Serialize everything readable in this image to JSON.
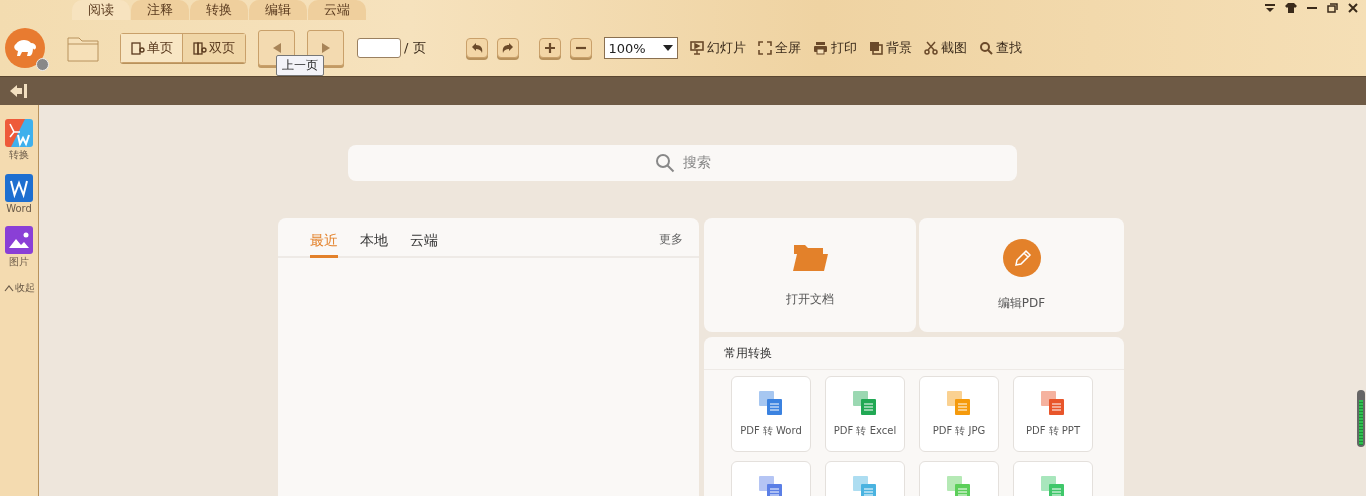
{
  "menu_tabs": [
    {
      "label": "阅读",
      "selected": true
    },
    {
      "label": "注释",
      "selected": false
    },
    {
      "label": "转换",
      "selected": false
    },
    {
      "label": "编辑",
      "selected": false
    },
    {
      "label": "云端",
      "selected": false
    }
  ],
  "toolbar": {
    "view_modes": [
      {
        "label": "单页",
        "selected": true
      },
      {
        "label": "双页",
        "selected": false
      }
    ],
    "tooltip": "上一页",
    "page_suffix": "/ 页",
    "zoom": "100%",
    "actions": [
      {
        "label": "幻灯片",
        "kind": "slideshow"
      },
      {
        "label": "全屏",
        "kind": "fullscreen"
      },
      {
        "label": "打印",
        "kind": "print"
      },
      {
        "label": "背景",
        "kind": "background"
      },
      {
        "label": "截图",
        "kind": "screenshot"
      },
      {
        "label": "查找",
        "kind": "search"
      }
    ]
  },
  "sidebar": {
    "items": [
      {
        "label": "转换",
        "kind": "convert"
      },
      {
        "label": "Word",
        "kind": "word"
      },
      {
        "label": "图片",
        "kind": "image"
      }
    ],
    "collapse": "收起"
  },
  "search": {
    "placeholder": "搜索"
  },
  "files": {
    "tabs": [
      {
        "label": "最近",
        "selected": true
      },
      {
        "label": "本地",
        "selected": false
      },
      {
        "label": "云端",
        "selected": false
      }
    ],
    "more": "更多"
  },
  "quick_actions": [
    {
      "label": "打开文档",
      "kind": "open"
    },
    {
      "label": "编辑PDF",
      "kind": "edit"
    }
  ],
  "conversions": {
    "title": "常用转换",
    "items": [
      {
        "label": "PDF 转 Word",
        "color": "#3b82e0"
      },
      {
        "label": "PDF 转 Excel",
        "color": "#21a854"
      },
      {
        "label": "PDF 转 JPG",
        "color": "#f59a0c"
      },
      {
        "label": "PDF 转 PPT",
        "color": "#e8552a"
      },
      {
        "color": "#5b7fe6"
      },
      {
        "color": "#4ab3e0"
      },
      {
        "color": "#5ccf5a"
      },
      {
        "color": "#3fc76a"
      }
    ]
  }
}
